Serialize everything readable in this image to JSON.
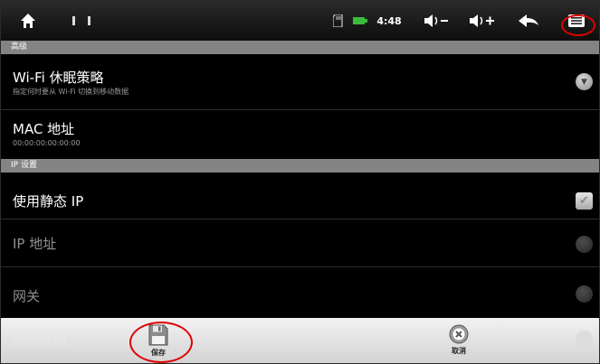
{
  "status_bar": {
    "time": "4:48"
  },
  "sections": [
    {
      "header": "高级"
    },
    {
      "header": "IP 设置"
    }
  ],
  "preferences": {
    "wifi_sleep": {
      "title": "Wi-Fi 休眠策略",
      "summary": "指定何时要从 Wi-Fi 切换到移动数据"
    },
    "mac_address": {
      "title": "MAC 地址",
      "summary": "00:00:00:00:00:00"
    },
    "use_static_ip": {
      "title": "使用静态 IP",
      "checked": true
    },
    "ip_address": {
      "title": "IP 地址"
    },
    "gateway": {
      "title": "网关"
    },
    "netmask_behind": {
      "title": "网络掩码"
    }
  },
  "option_menu": {
    "save_label": "保存",
    "cancel_label": "取消"
  },
  "colors": {
    "section_header_bg": "#848484",
    "annotation_red": "#e00000",
    "menu_bg": "#e6e6e6"
  },
  "icons": [
    "home-icon",
    "sd-card-icon",
    "battery-icon",
    "volume-down-icon",
    "volume-up-icon",
    "back-icon",
    "menu-icon",
    "floppy-save-icon",
    "cancel-circle-icon"
  ]
}
